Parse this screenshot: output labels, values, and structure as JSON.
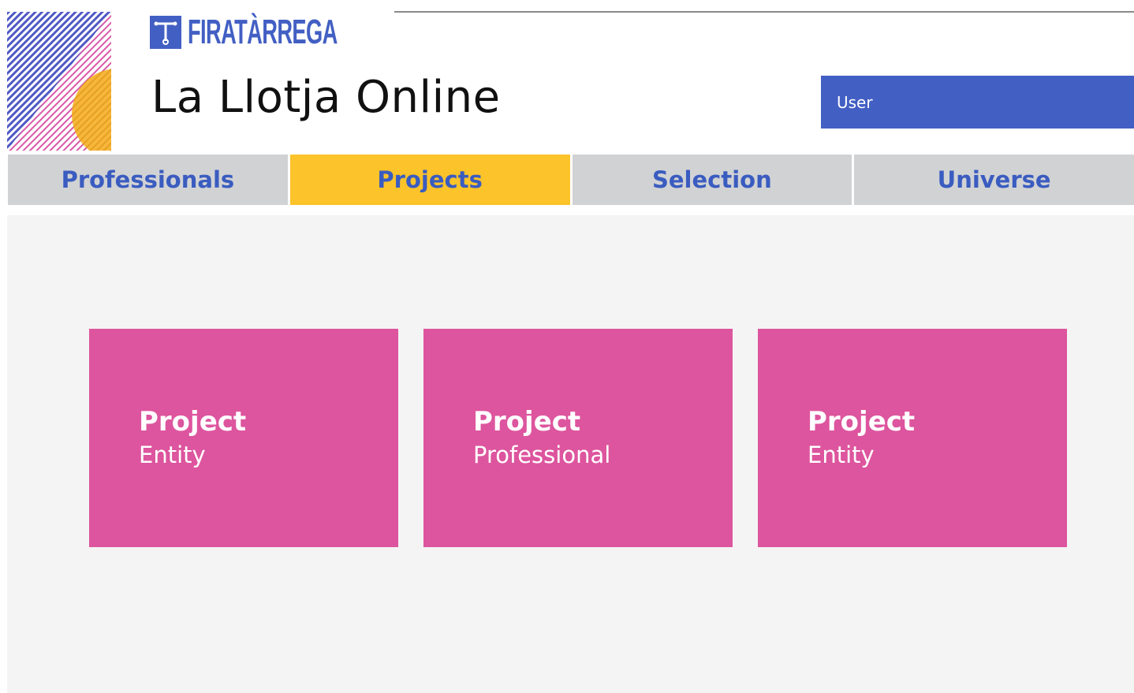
{
  "brand": {
    "logo_text": "FIRATÀRREGA",
    "site_title": "La Llotja Online",
    "primary_color": "#425fc3",
    "accent_color": "#fcc32a",
    "card_color": "#dd559e"
  },
  "user": {
    "label": "User"
  },
  "nav": {
    "tabs": [
      {
        "label": "Professionals"
      },
      {
        "label": "Projects"
      },
      {
        "label": "Selection"
      },
      {
        "label": "Universe"
      }
    ],
    "active": "Projects"
  },
  "cards": [
    {
      "title": "Project",
      "subtitle": "Entity"
    },
    {
      "title": "Project",
      "subtitle": "Professional"
    },
    {
      "title": "Project",
      "subtitle": "Entity"
    }
  ]
}
